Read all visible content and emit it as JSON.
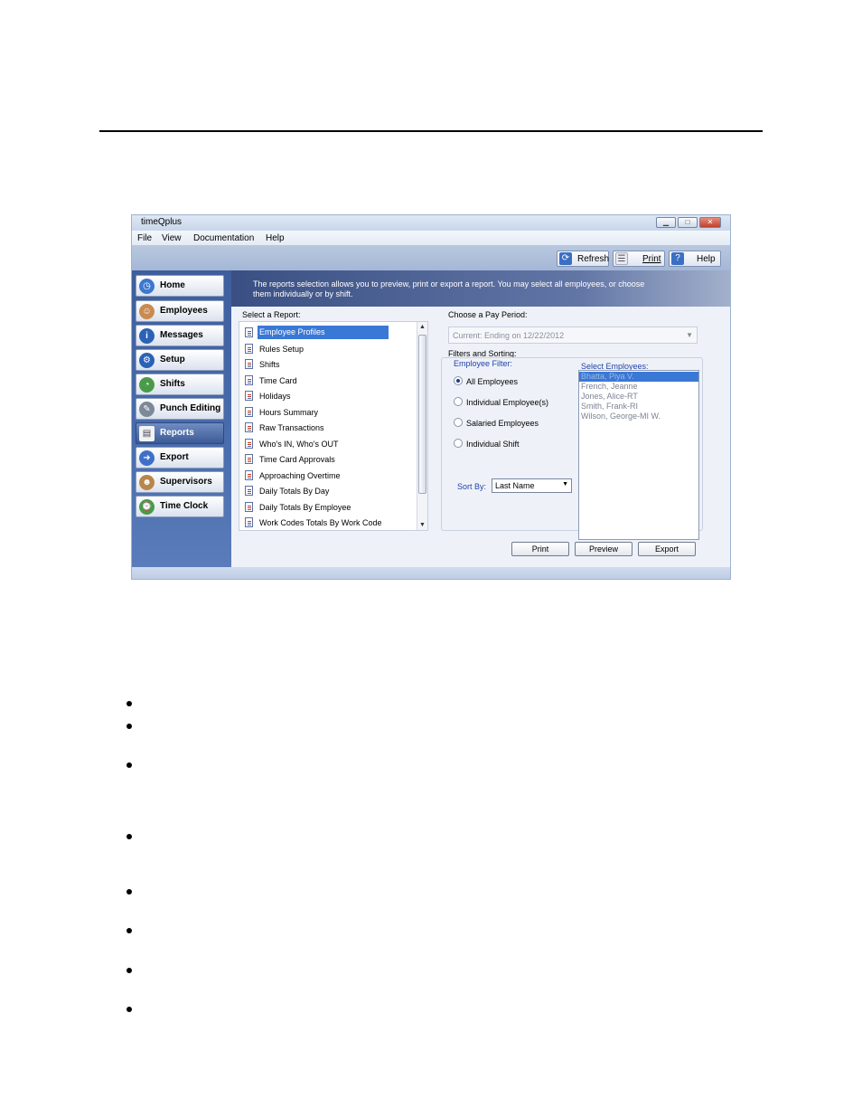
{
  "window": {
    "title": "timeQplus",
    "menu": [
      "File",
      "View",
      "Documentation",
      "Help"
    ],
    "toolbar": {
      "refresh": "Refresh",
      "print": "Print",
      "help": "Help"
    }
  },
  "sidebar": {
    "items": [
      {
        "label": "Home",
        "icon": "clock-icon"
      },
      {
        "label": "Employees",
        "icon": "person-icon"
      },
      {
        "label": "Messages",
        "icon": "info-icon"
      },
      {
        "label": "Setup",
        "icon": "gear-icon"
      },
      {
        "label": "Shifts",
        "icon": "shift-clock-icon"
      },
      {
        "label": "Punch Editing",
        "icon": "edit-icon"
      },
      {
        "label": "Reports",
        "icon": "report-icon",
        "active": true
      },
      {
        "label": "Export",
        "icon": "export-icon"
      },
      {
        "label": "Supervisors",
        "icon": "group-icon"
      },
      {
        "label": "Time Clock",
        "icon": "timeclock-icon"
      }
    ]
  },
  "header": {
    "text": "The reports selection allows you to preview, print or export a report. You may select all employees, or choose them individually or by shift."
  },
  "reports": {
    "label": "Select a Report:",
    "items": [
      "Employee Profiles",
      "Rules Setup",
      "Shifts",
      "Time Card",
      "Holidays",
      "Hours Summary",
      "Raw Transactions",
      "Who's IN, Who's OUT",
      "Time Card Approvals",
      "Approaching Overtime",
      "Daily Totals By Day",
      "Daily Totals By Employee",
      "Work Codes Totals By Work Code"
    ],
    "selected_index": 0
  },
  "pay_period": {
    "label": "Choose a Pay Period:",
    "value": "Current:  Ending on 12/22/2012"
  },
  "filters": {
    "label": "Filters and Sorting:",
    "employee_filter_label": "Employee Filter:",
    "options": [
      "All Employees",
      "Individual Employee(s)",
      "Salaried Employees",
      "Individual Shift"
    ],
    "selected_option": 0,
    "sort_label": "Sort By:",
    "sort_value": "Last Name"
  },
  "employees": {
    "label": "Select Employees:",
    "items": [
      "Bhatta, Piya V.",
      "French, Jeanne",
      "Jones, Alice-RT",
      "Smith, Frank-RI",
      "Wilson, George-MI W."
    ]
  },
  "actions": {
    "print": "Print",
    "preview": "Preview",
    "export": "Export"
  }
}
